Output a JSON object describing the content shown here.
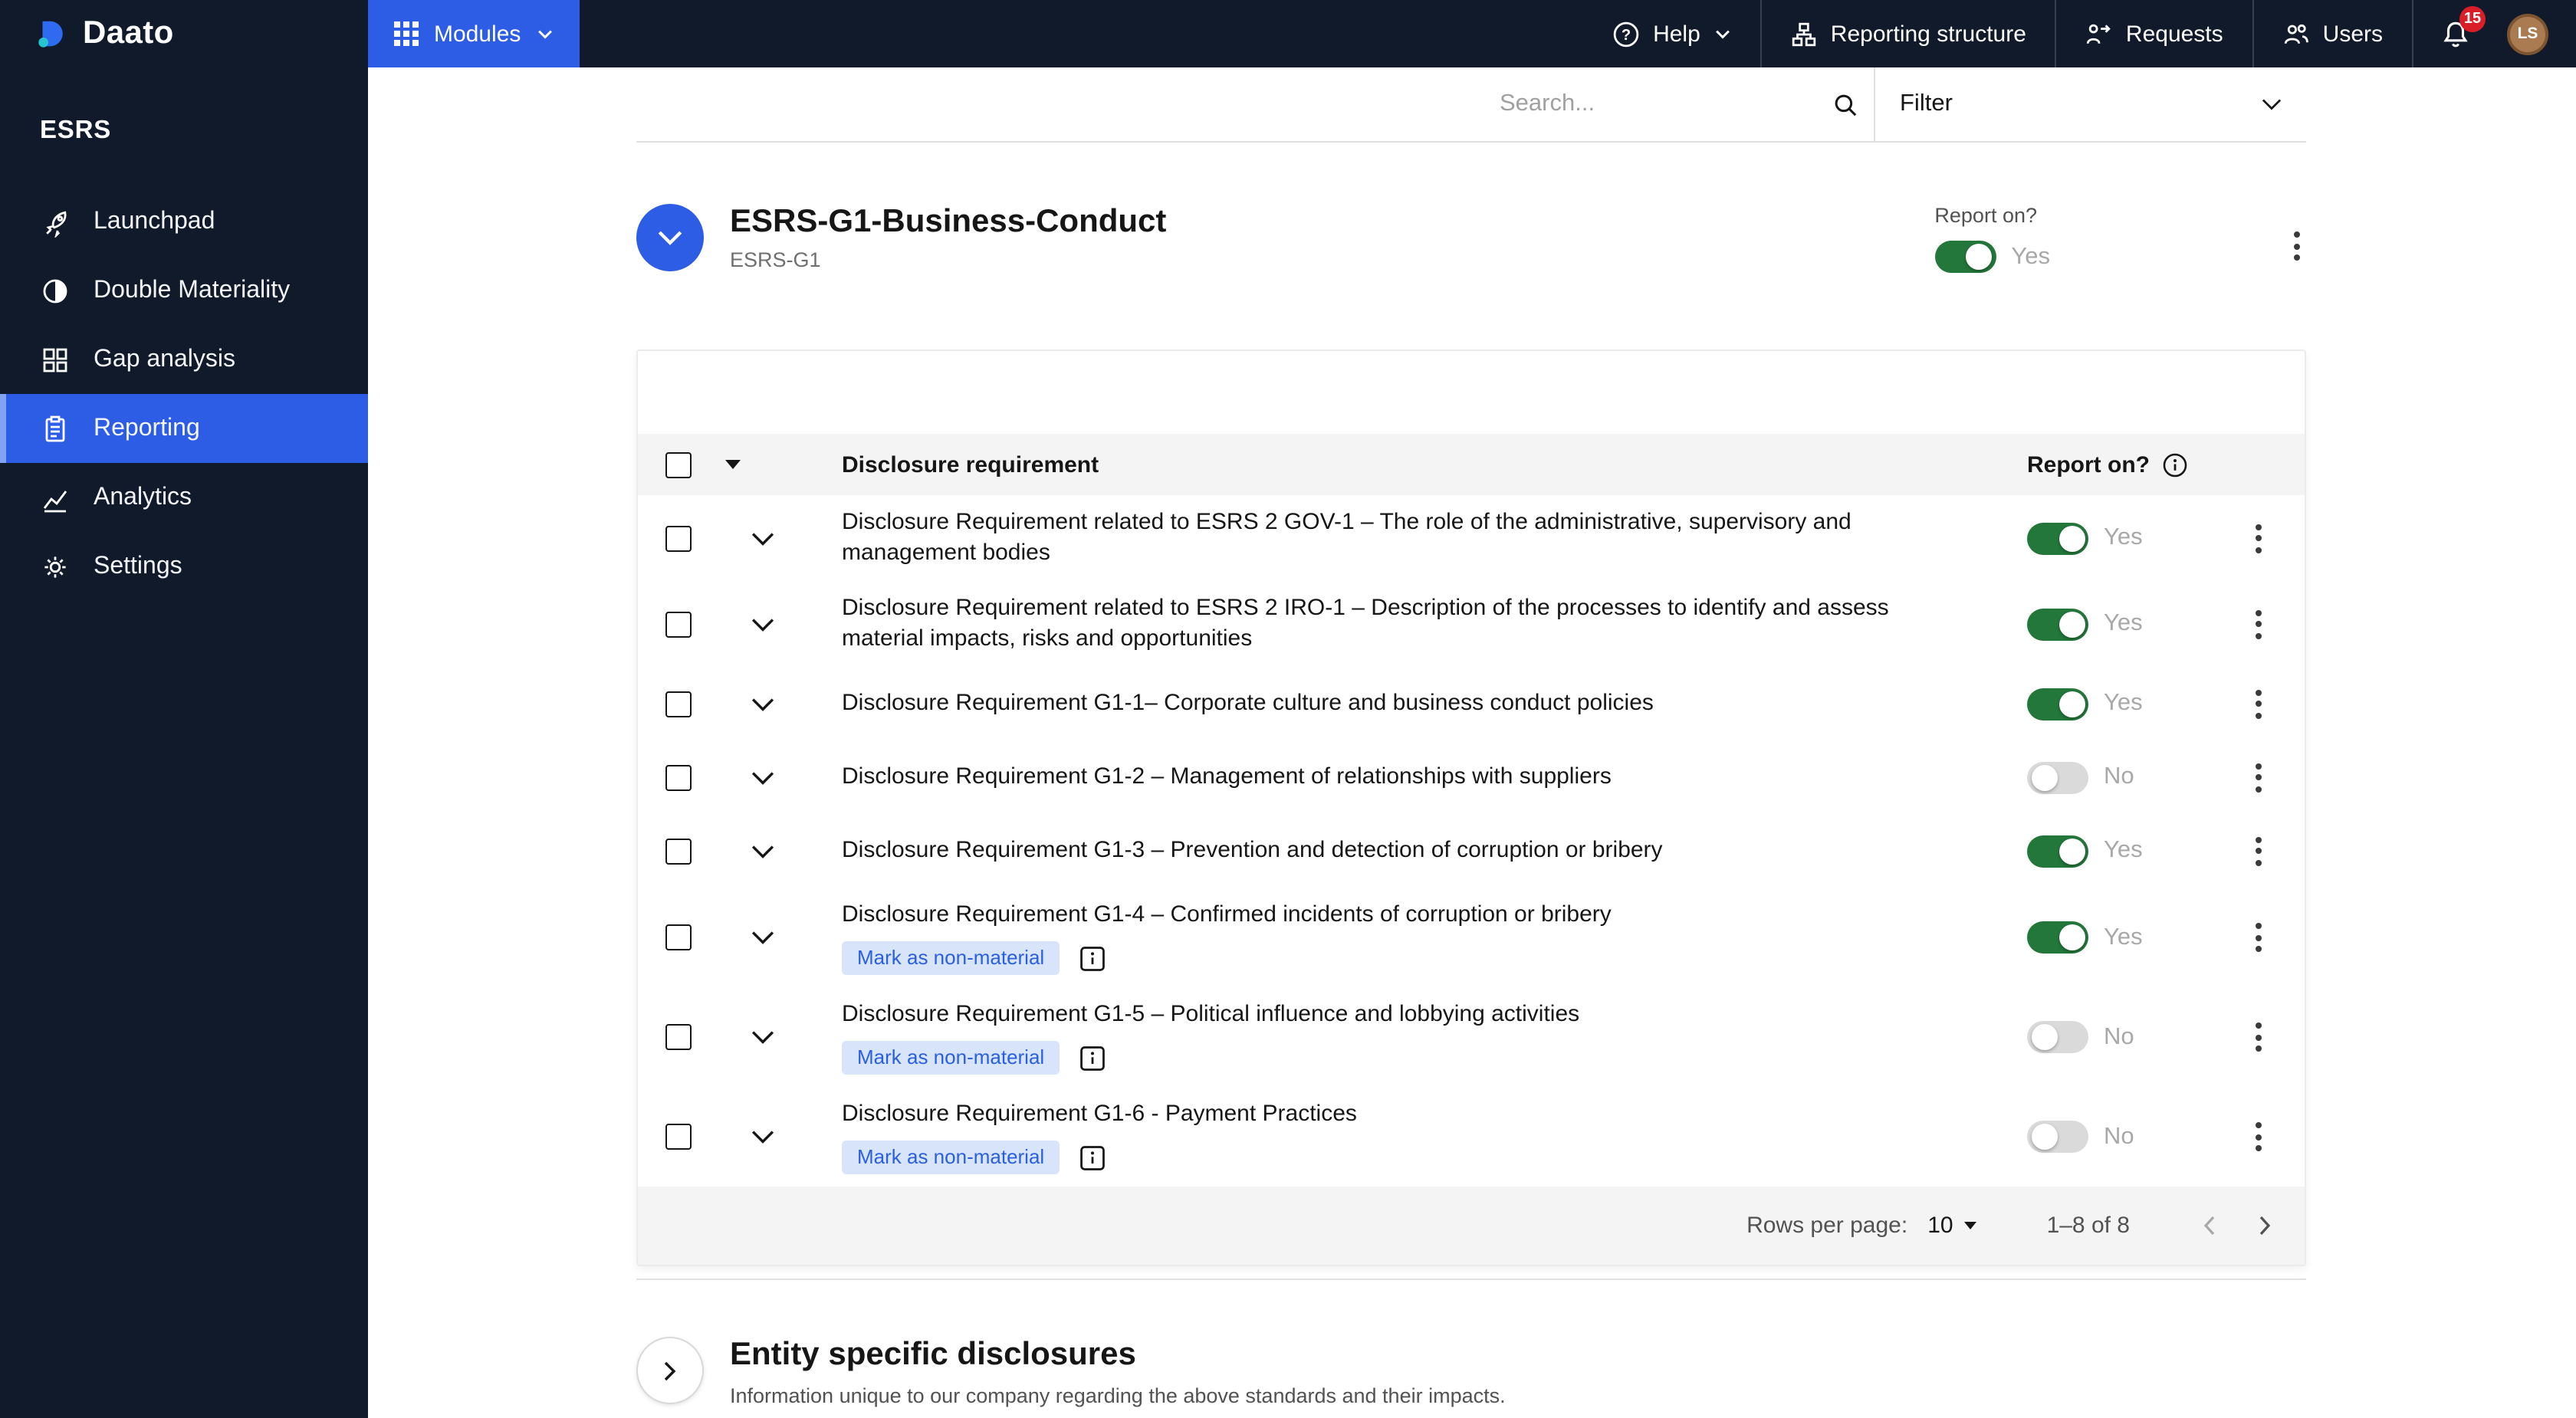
{
  "topbar": {
    "brand": "Daato",
    "modules": "Modules",
    "help": "Help",
    "links": [
      {
        "label": "Reporting structure"
      },
      {
        "label": "Requests"
      },
      {
        "label": "Users"
      }
    ],
    "notifications": "15",
    "avatar": "LS"
  },
  "sidebar": {
    "section": "ESRS",
    "items": [
      {
        "label": "Launchpad"
      },
      {
        "label": "Double Materiality"
      },
      {
        "label": "Gap analysis"
      },
      {
        "label": "Reporting"
      },
      {
        "label": "Analytics"
      },
      {
        "label": "Settings"
      }
    ],
    "active": "Reporting"
  },
  "toolbar": {
    "search_placeholder": "Search...",
    "filter": "Filter"
  },
  "page": {
    "title": "ESRS-G1-Business-Conduct",
    "subtitle": "ESRS-G1",
    "report_on_label": "Report on?",
    "report_on_state": "Yes"
  },
  "table": {
    "header": {
      "disclosure": "Disclosure requirement",
      "report_on": "Report on?"
    },
    "rows": [
      {
        "text": "Disclosure Requirement related to ESRS 2 GOV-1 – The role of the administrative, supervisory and management bodies",
        "on": true,
        "state": "Yes",
        "pill": null
      },
      {
        "text": "Disclosure Requirement related to ESRS 2 IRO-1 – Description of the processes to identify and assess material impacts, risks and opportunities",
        "on": true,
        "state": "Yes",
        "pill": null
      },
      {
        "text": "Disclosure Requirement G1-1– Corporate culture and business conduct policies",
        "on": true,
        "state": "Yes",
        "pill": null
      },
      {
        "text": "Disclosure Requirement G1-2 – Management of relationships with suppliers",
        "on": false,
        "state": "No",
        "pill": null
      },
      {
        "text": "Disclosure Requirement G1-3 – Prevention and detection of corruption or bribery",
        "on": true,
        "state": "Yes",
        "pill": null
      },
      {
        "text": "Disclosure Requirement G1-4 – Confirmed incidents of corruption or bribery",
        "on": true,
        "state": "Yes",
        "pill": "Mark as non-material"
      },
      {
        "text": "Disclosure Requirement G1-5 – Political influence and lobbying activities",
        "on": false,
        "state": "No",
        "pill": "Mark as non-material"
      },
      {
        "text": "Disclosure Requirement G1-6 - Payment Practices",
        "on": false,
        "state": "No",
        "pill": "Mark as non-material"
      }
    ],
    "footer": {
      "rows_per_page_label": "Rows per page:",
      "rows_per_page": "10",
      "range": "1–8 of 8"
    }
  },
  "entity": {
    "title": "Entity specific disclosures",
    "subtitle": "Information unique to our company regarding the above standards and their impacts."
  },
  "colors": {
    "accent_blue": "#2D5DE5",
    "navy": "#111A2B",
    "toggle_on_green": "#23773B",
    "toggle_off_gray": "#DADADA",
    "badge_red": "#DA1E28",
    "pill_bg": "#D7E4FA",
    "pill_text": "#2A5FE0"
  }
}
